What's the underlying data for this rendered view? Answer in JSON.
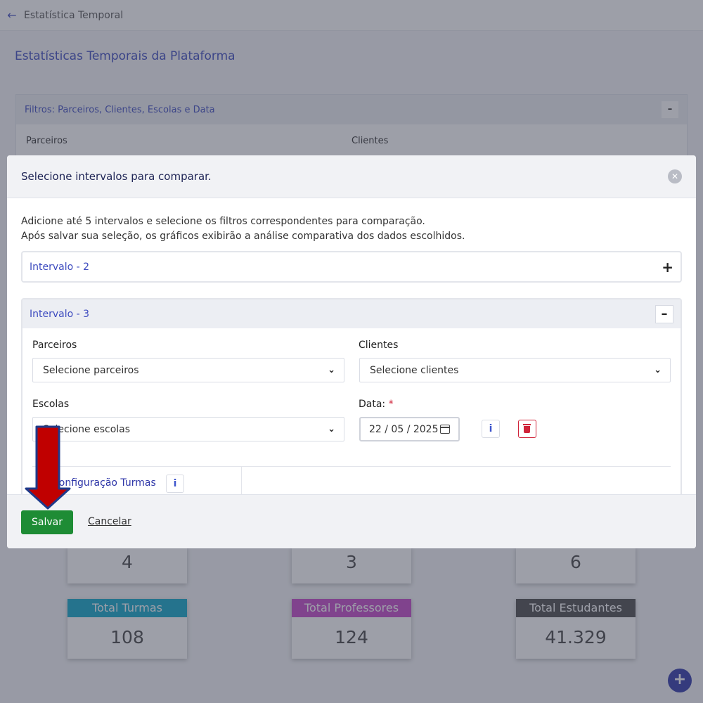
{
  "topbar": {
    "title": "Estatística Temporal"
  },
  "page": {
    "title": "Estatísticas Temporais da Plataforma"
  },
  "filters": {
    "title": "Filtros: Parceiros, Clientes, Escolas e Data",
    "labels": [
      "Parceiros",
      "Clientes"
    ]
  },
  "stats_top": [
    "4",
    "3",
    "6"
  ],
  "stats": [
    {
      "label": "Total Turmas",
      "value": "108",
      "color": "#0fa7c9"
    },
    {
      "label": "Total Professores",
      "value": "124",
      "color": "#c447c9"
    },
    {
      "label": "Total Estudantes",
      "value": "41.329",
      "color": "#4a4a4a"
    }
  ],
  "modal": {
    "title": "Selecione intervalos para comparar.",
    "desc_line1": "Adicione até 5 intervalos e selecione os filtros correspondentes para comparação.",
    "desc_line2": "Após salvar sua seleção, os gráficos exibirão a análise comparativa dos dados escolhidos.",
    "intervals": [
      {
        "label": "Intervalo - 2",
        "state": "collapsed"
      },
      {
        "label": "Intervalo - 3",
        "state": "expanded"
      }
    ],
    "form": {
      "parceiros_label": "Parceiros",
      "parceiros_value": "Selecione parceiros",
      "clientes_label": "Clientes",
      "clientes_value": "Selecione clientes",
      "escolas_label": "Escolas",
      "escolas_value": "Selecione escolas",
      "data_label": "Data:",
      "data_required": "*",
      "date_value": "22 / 05 / 2025"
    },
    "config_label": "Configuração Turmas",
    "save_label": "Salvar",
    "cancel_label": "Cancelar"
  },
  "colors": {
    "accent": "#3d4bbf",
    "save": "#1e8c35",
    "danger": "#d0243a",
    "annotation_arrow": "#c00000"
  }
}
